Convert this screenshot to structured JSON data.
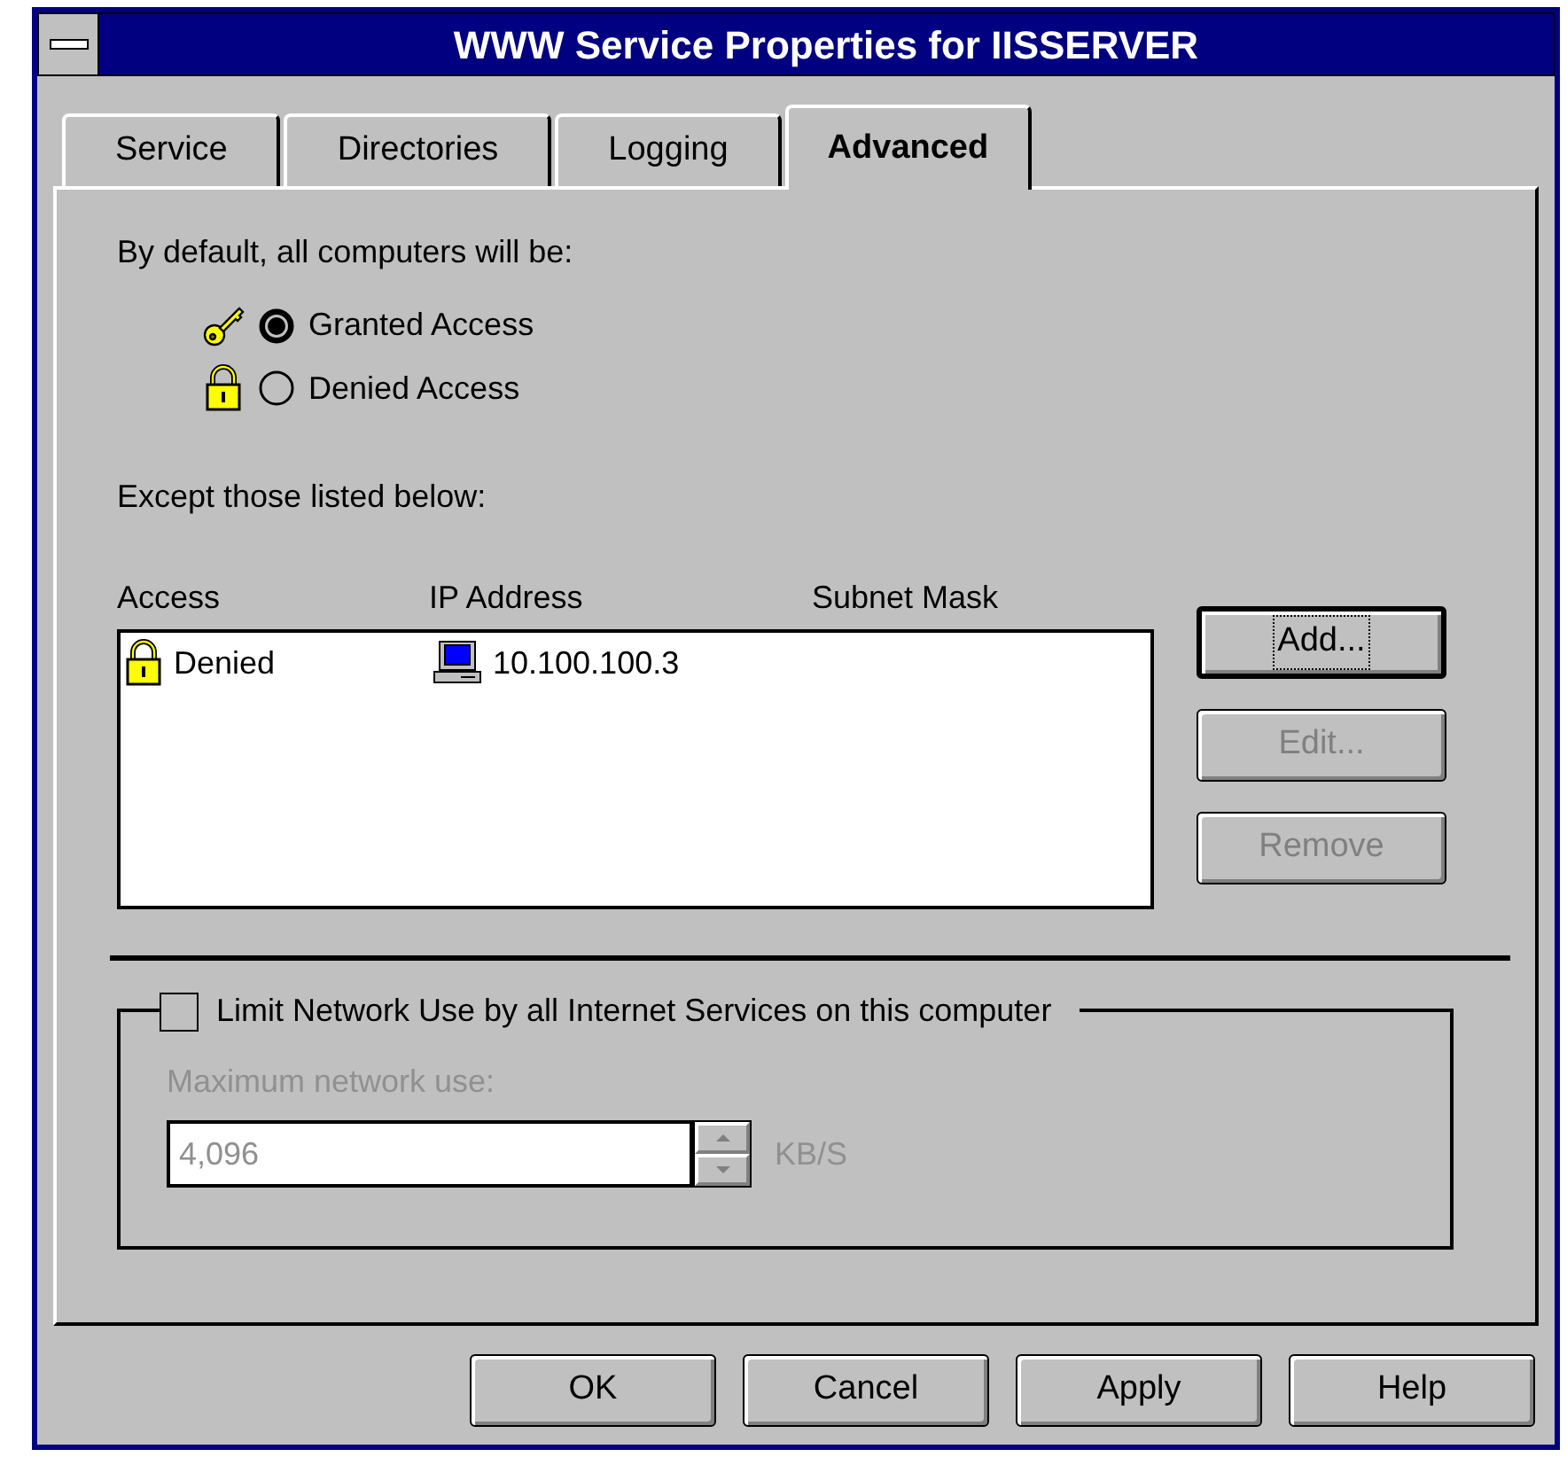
{
  "window": {
    "title": "WWW Service Properties for IISSERVER"
  },
  "tabs": [
    {
      "label": "Service",
      "selected": false
    },
    {
      "label": "Directories",
      "selected": false
    },
    {
      "label": "Logging",
      "selected": false
    },
    {
      "label": "Advanced",
      "selected": true
    }
  ],
  "default_label": "By default, all computers will be:",
  "access_options": [
    {
      "kind": "granted",
      "label": "Granted Access",
      "selected": true
    },
    {
      "kind": "denied",
      "label": "Denied Access",
      "selected": false
    }
  ],
  "except_label": "Except those listed below:",
  "table": {
    "columns": [
      "Access",
      "IP Address",
      "Subnet Mask"
    ],
    "rows": [
      {
        "kind": "denied",
        "access": "Denied",
        "ip_address": "10.100.100.3"
      }
    ]
  },
  "side_buttons": [
    {
      "label": "Add...",
      "disabled": false,
      "focused": true
    },
    {
      "label": "Edit...",
      "disabled": true,
      "focused": false
    },
    {
      "label": "Remove",
      "disabled": true,
      "focused": false
    }
  ],
  "limit_group": {
    "label": "Limit Network Use by all Internet Services on this computer",
    "checked": false,
    "disabled": true,
    "max_label": "Maximum network use:",
    "value": "4,096",
    "unit": "KB/S"
  },
  "buttons": [
    "OK",
    "Cancel",
    "Apply",
    "Help"
  ]
}
